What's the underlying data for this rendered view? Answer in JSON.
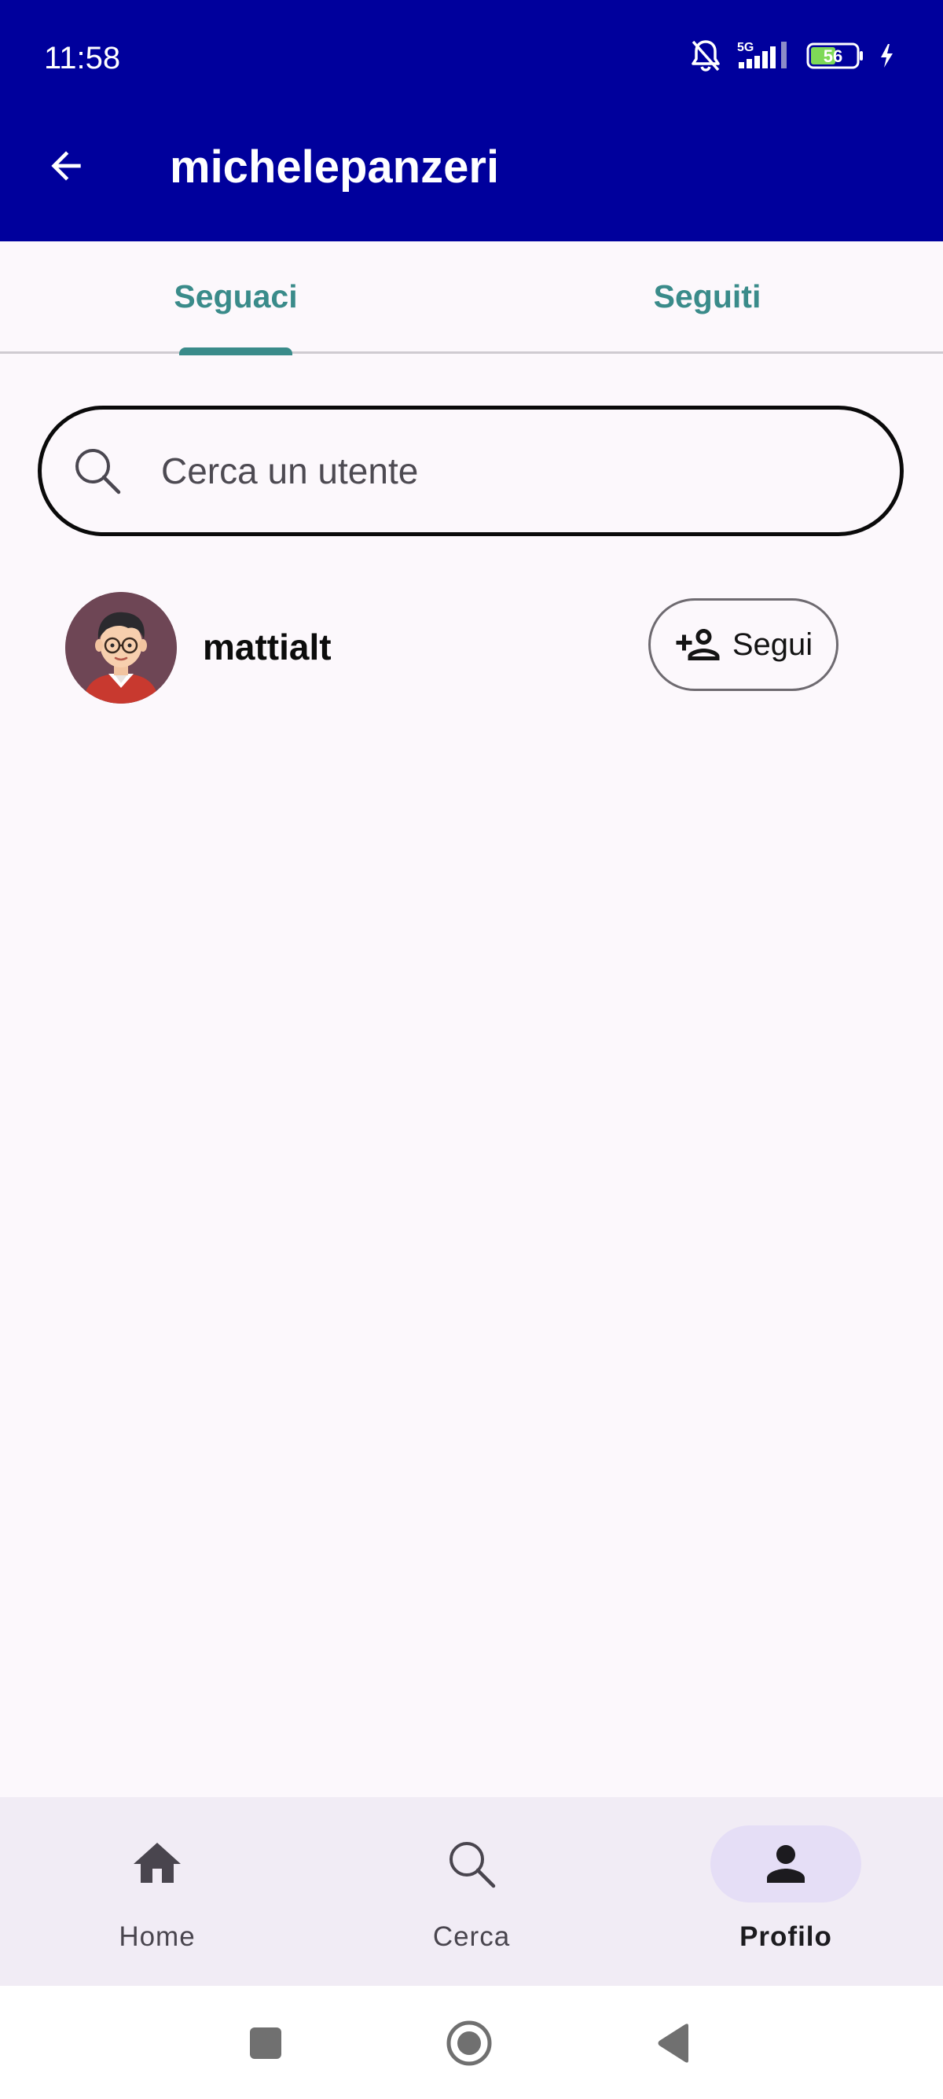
{
  "status_bar": {
    "time": "11:58",
    "network": "5G",
    "battery_level": "56",
    "icons": [
      "bell-off-icon",
      "signal-icon",
      "battery-icon",
      "charging-icon"
    ]
  },
  "app_bar": {
    "title": "michelepanzeri",
    "back_icon": "arrow-back-icon"
  },
  "tabs": [
    {
      "label": "Seguaci",
      "selected": true
    },
    {
      "label": "Seguiti",
      "selected": false
    }
  ],
  "search": {
    "placeholder": "Cerca un utente",
    "value": "",
    "icon": "search-icon"
  },
  "users": [
    {
      "username": "mattialt",
      "avatar": "cartoon-avatar",
      "action_label": "Segui",
      "action_icon": "person-add-icon"
    }
  ],
  "bottom_nav": [
    {
      "label": "Home",
      "icon": "home-icon",
      "selected": false
    },
    {
      "label": "Cerca",
      "icon": "search-icon",
      "selected": false
    },
    {
      "label": "Profilo",
      "icon": "person-icon",
      "selected": true
    }
  ],
  "system_nav": [
    "recents-button",
    "home-button",
    "back-button"
  ],
  "colors": {
    "app_bar": "#00009c",
    "accent": "#3a8b8a",
    "background": "#fcf8fc",
    "nav_background": "#f1ecf5",
    "nav_pill": "#e5def6"
  }
}
